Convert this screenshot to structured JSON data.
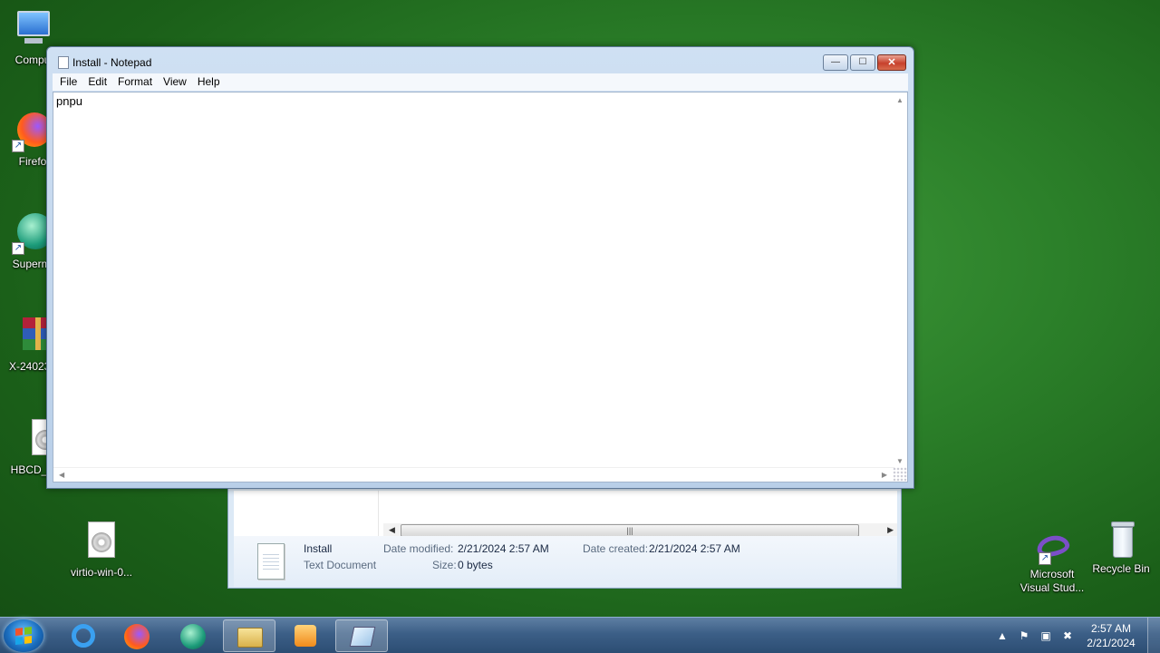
{
  "desktop": {
    "icons": [
      {
        "label": "Compu",
        "icon": "computer-icon"
      },
      {
        "label": "Firefo",
        "icon": "firefox-icon"
      },
      {
        "label": "Supermi",
        "icon": "supermium-icon"
      },
      {
        "label": "X-240237",
        "icon": "winrar-icon"
      },
      {
        "label": "HBCD_P",
        "icon": "disc-image-icon"
      },
      {
        "label": "virtio-win-0...",
        "icon": "disc-image-icon"
      },
      {
        "label": "Microsoft Visual Stud...",
        "icon": "visual-studio-icon"
      },
      {
        "label": "Recycle Bin",
        "icon": "recycle-bin-icon"
      }
    ]
  },
  "notepad": {
    "title": "Install - Notepad",
    "menu": [
      "File",
      "Edit",
      "Format",
      "View",
      "Help"
    ],
    "content": "pnpu",
    "buttons": {
      "minimize": "—",
      "maximize": "☐",
      "close": "✕"
    }
  },
  "explorer_details": {
    "file_name": "Install",
    "file_type": "Text Document",
    "date_modified_label": "Date modified:",
    "date_modified": "2/21/2024 2:57 AM",
    "date_created_label": "Date created:",
    "date_created": "2/21/2024 2:57 AM",
    "size_label": "Size:",
    "size": "0 bytes"
  },
  "taskbar": {
    "apps": [
      "internet-explorer-icon",
      "firefox-icon",
      "supermium-icon",
      "file-explorer-icon",
      "media-player-icon",
      "notepad-icon"
    ],
    "clock_time": "2:57 AM",
    "clock_date": "2/21/2024"
  },
  "colors": {
    "desktop_green": "#2b7f29",
    "taskbar_blue": "#3c5f87",
    "close_red": "#c7412c"
  }
}
